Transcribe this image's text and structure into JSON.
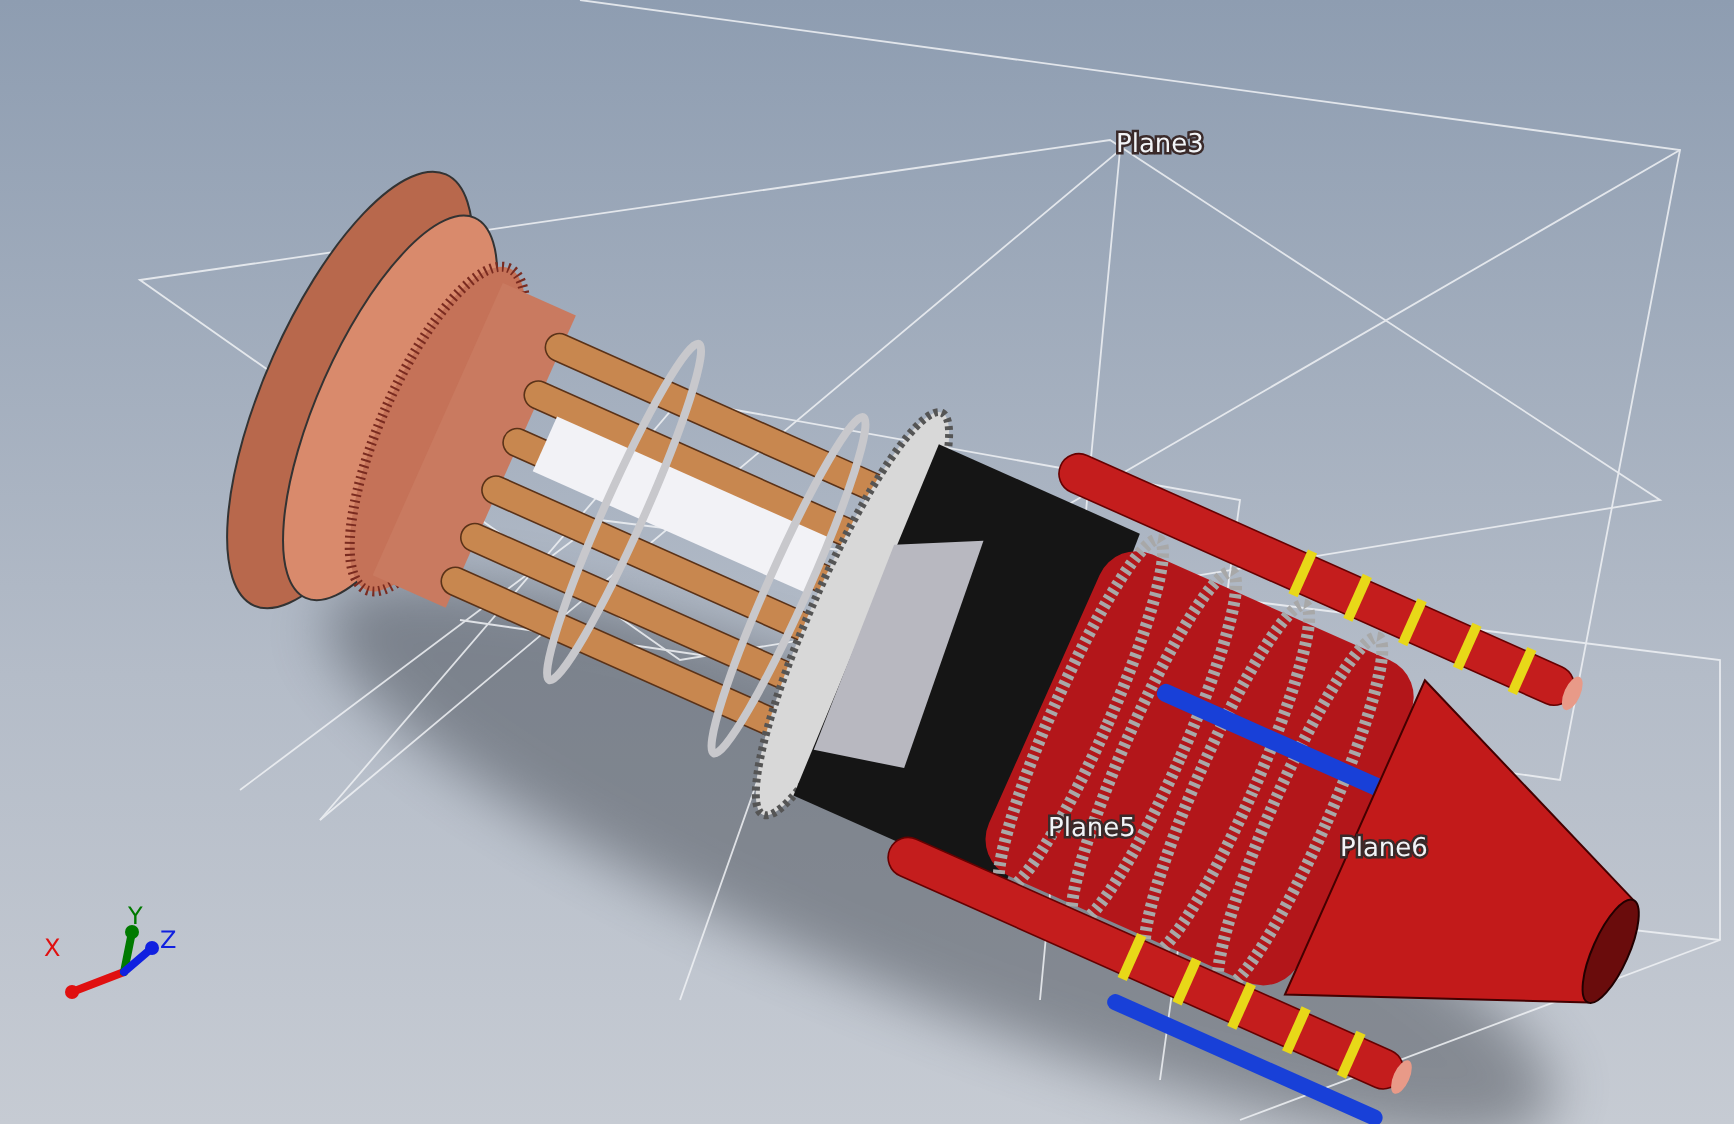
{
  "viewport": {
    "planes": [
      {
        "label": "Plane3"
      },
      {
        "label": "Plane5"
      },
      {
        "label": "Plane6"
      }
    ],
    "triad": {
      "axes": [
        {
          "label": "X",
          "color": "#e01010"
        },
        {
          "label": "Y",
          "color": "#007a00"
        },
        {
          "label": "Z",
          "color": "#1020e0"
        }
      ]
    }
  }
}
